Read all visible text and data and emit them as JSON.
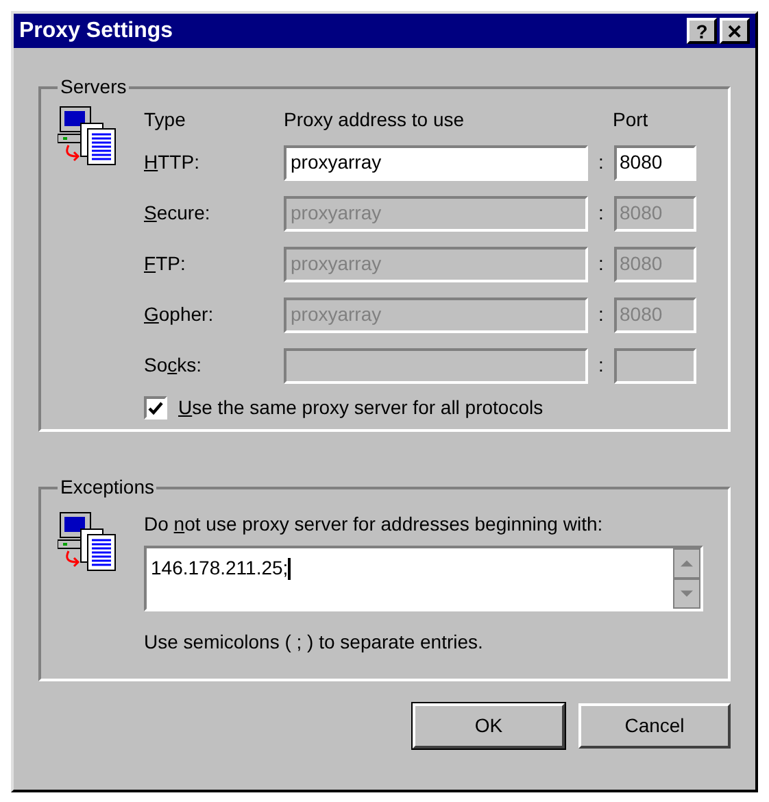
{
  "window": {
    "title": "Proxy Settings",
    "title_buttons": [
      "?",
      "✕"
    ]
  },
  "servers": {
    "title": "Servers",
    "headers": {
      "type": "Type",
      "address": "Proxy address to use",
      "port": "Port"
    },
    "rows": [
      {
        "label": {
          "key": "H",
          "after": "TTP:"
        },
        "address": "proxyarray",
        "port": "8080",
        "disabled": false
      },
      {
        "label": {
          "key": "S",
          "after": "ecure:"
        },
        "address": "proxyarray",
        "port": "8080",
        "disabled": true
      },
      {
        "label": {
          "key": "F",
          "after": "TP:"
        },
        "address": "proxyarray",
        "port": "8080",
        "disabled": true
      },
      {
        "label": {
          "key": "G",
          "after": "opher:"
        },
        "address": "proxyarray",
        "port": "8080",
        "disabled": true
      },
      {
        "label": {
          "before": "So",
          "key": "c",
          "after": "ks:"
        },
        "disabled": true
      }
    ],
    "separator": ":",
    "same_proxy": {
      "label": {
        "key": "U",
        "after": "se the same proxy server for all protocols"
      },
      "checked": true
    }
  },
  "exceptions": {
    "title": "Exceptions",
    "prompt": {
      "before": "Do ",
      "key": "n",
      "after": "ot use proxy server for addresses beginning with:"
    },
    "value": "146.178.211.25;",
    "hint": "Use semicolons ( ; ) to separate entries."
  },
  "buttons": [
    {
      "label": "OK",
      "default": true
    },
    {
      "label": "Cancel",
      "default": false
    }
  ]
}
